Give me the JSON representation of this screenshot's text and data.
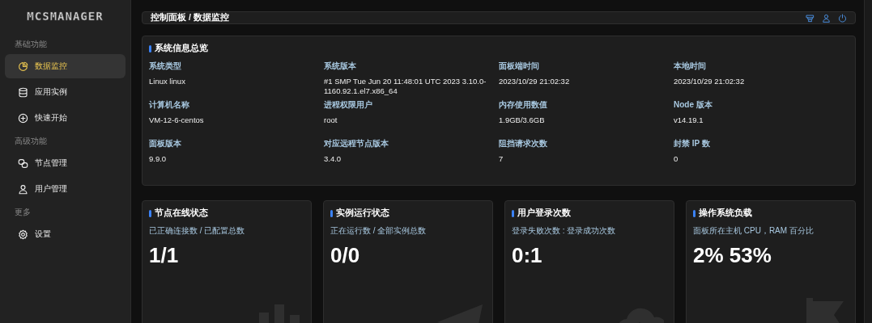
{
  "sidebar": {
    "logo": "MCSMANAGER",
    "sections": [
      {
        "label": "基础功能",
        "items": [
          {
            "label": "数据监控",
            "selected": true
          },
          {
            "label": "应用实例",
            "selected": false
          },
          {
            "label": "快速开始",
            "selected": false
          }
        ]
      },
      {
        "label": "高级功能",
        "items": [
          {
            "label": "节点管理",
            "selected": false
          },
          {
            "label": "用户管理",
            "selected": false
          }
        ]
      },
      {
        "label": "更多",
        "items": [
          {
            "label": "设置",
            "selected": false
          }
        ]
      }
    ]
  },
  "header": {
    "breadcrumb": "控制面板 / 数据监控"
  },
  "system_info": {
    "title": "系统信息总览",
    "fields": [
      {
        "label": "系统类型",
        "value": "Linux linux"
      },
      {
        "label": "系统版本",
        "value": "#1 SMP Tue Jun 20 11:48:01 UTC 2023 3.10.0-1160.92.1.el7.x86_64"
      },
      {
        "label": "面板端时间",
        "value": "2023/10/29 21:02:32"
      },
      {
        "label": "本地时间",
        "value": "2023/10/29 21:02:32"
      },
      {
        "label": "计算机名称",
        "value": "VM-12-6-centos"
      },
      {
        "label": "进程权限用户",
        "value": "root"
      },
      {
        "label": "内存使用数值",
        "value": "1.9GB/3.6GB"
      },
      {
        "label": "Node 版本",
        "value": "v14.19.1"
      },
      {
        "label": "面板版本",
        "value": "9.9.0"
      },
      {
        "label": "对应远程节点版本",
        "value": "3.4.0"
      },
      {
        "label": "阻挡请求次数",
        "value": "7"
      },
      {
        "label": "封禁 IP 数",
        "value": "0"
      }
    ]
  },
  "stat_cards": [
    {
      "title": "节点在线状态",
      "subtitle": "已正确连接数 / 已配置总数",
      "value": "1/1"
    },
    {
      "title": "实例运行状态",
      "subtitle": "正在运行数 / 全部实例总数",
      "value": "0/0"
    },
    {
      "title": "用户登录次数",
      "subtitle": "登录失败次数 : 登录成功次数",
      "value": "0:1"
    },
    {
      "title": "操作系统负载",
      "subtitle": "面板所在主机 CPU，RAM 百分比",
      "value": "2% 53%"
    }
  ]
}
